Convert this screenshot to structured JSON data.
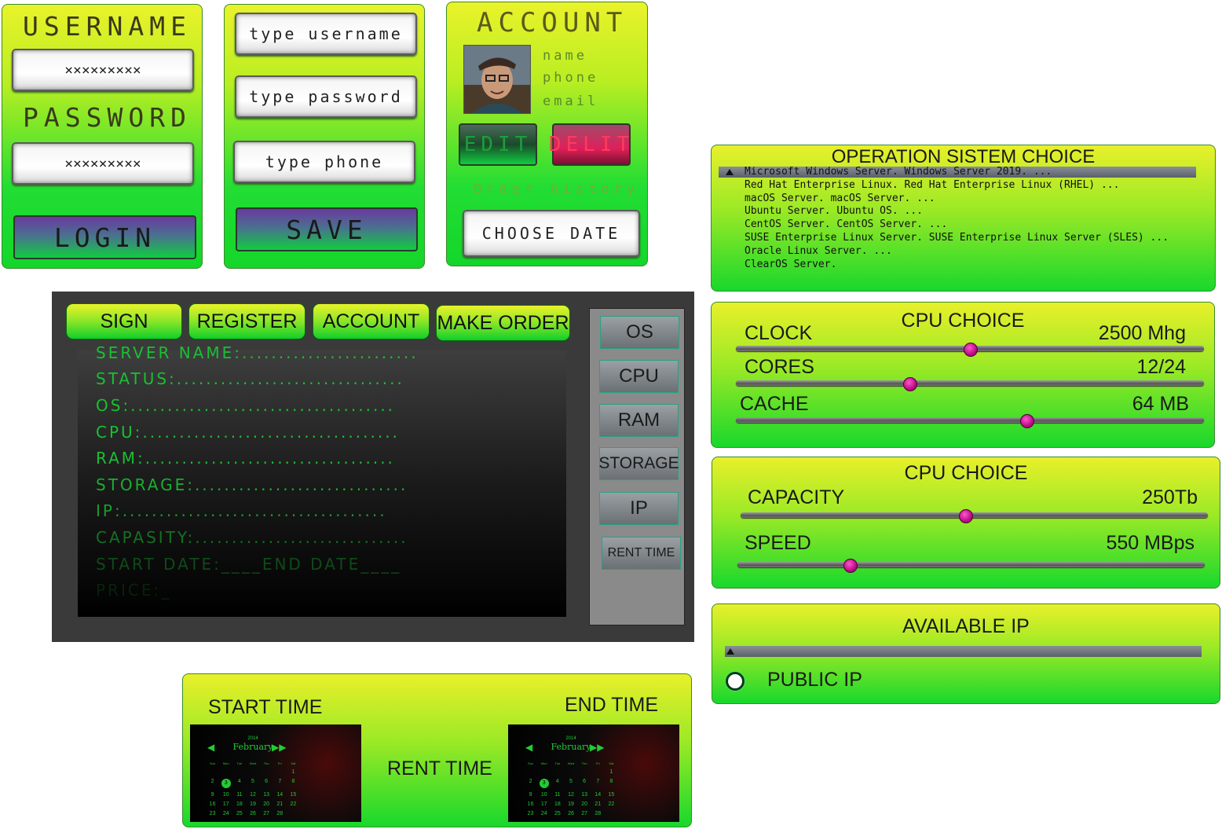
{
  "login": {
    "username_label": "USERNAME",
    "username_value": "×××××××××",
    "password_label": "PASSWORD",
    "password_value": "×××××××××",
    "login_button": "LOGIN"
  },
  "register": {
    "username_placeholder": "type username",
    "password_placeholder": "type password",
    "phone_placeholder": "type phone",
    "save_button": "SAVE"
  },
  "account": {
    "title": "ACCOUNT",
    "name": "name",
    "phone": "phone",
    "email": "email",
    "edit_button": "EDIT",
    "delete_button": "DELIT",
    "order_history": "Order history",
    "choose_date_button": "CHOOSE DATE"
  },
  "os_choice": {
    "title": "OPERATION SISTEM CHOICE",
    "items": [
      "Microsoft Windows Server. Windows Server 2019. ...",
      "Red Hat Enterprise Linux. Red Hat Enterprise Linux (RHEL) ...",
      "macOS Server. macOS Server. ...",
      "Ubuntu Server. Ubuntu OS. ...",
      "CentOS Server. CentOS Server. ...",
      "SUSE Enterprise Linux Server. SUSE Enterprise Linux Server (SLES) ...",
      "Oracle Linux Server. ...",
      "ClearOS Server."
    ],
    "selected_index": 0
  },
  "cpu_choice": {
    "title": "CPU CHOICE",
    "rows": [
      {
        "label": "CLOCK",
        "value": "2500 Mhg",
        "level": 0.5
      },
      {
        "label": "CORES",
        "value": "12/24",
        "level": 0.37
      },
      {
        "label": "CACHE",
        "value": "64 MB",
        "level": 0.62
      }
    ]
  },
  "storage_choice": {
    "title": "CPU CHOICE",
    "rows": [
      {
        "label": "CAPACITY",
        "value": "250Tb",
        "level": 0.48
      },
      {
        "label": "SPEED",
        "value": "550 MBps",
        "level": 0.24
      }
    ]
  },
  "available_ip": {
    "title": "AVAILABLE IP",
    "public_ip_label": "PUBLIC IP"
  },
  "main": {
    "tabs": [
      "SIGN",
      "REGISTER",
      "ACCOUNT",
      "MAKE ORDER"
    ],
    "status_lines": [
      "SERVER NAME:........................",
      "STATUS:...............................",
      "OS:....................................",
      "CPU:...................................",
      "RAM:..................................",
      "STORAGE:.............................",
      "IP:....................................",
      "CAPASITY:.............................",
      "START DATE:____END DATE____",
      "PRICE:_"
    ],
    "side_buttons": [
      "OS",
      "CPU",
      "RAM",
      "STORAGE",
      "IP",
      "RENT TIME"
    ]
  },
  "rent": {
    "start_label": "START TIME",
    "end_label": "END TIME",
    "center_label": "RENT TIME",
    "calendar": {
      "year": "2014",
      "month": "February",
      "weekdays": [
        "Sun",
        "Mon",
        "Tue",
        "Wed",
        "Thu",
        "Fri",
        "Sat"
      ],
      "days": [
        "",
        "",
        "",
        "",
        "",
        "",
        "1",
        "2",
        "3",
        "4",
        "5",
        "6",
        "7",
        "8",
        "9",
        "10",
        "11",
        "12",
        "13",
        "14",
        "15",
        "16",
        "17",
        "18",
        "19",
        "20",
        "21",
        "22",
        "23",
        "24",
        "25",
        "26",
        "27",
        "28"
      ],
      "selected_day": "3"
    }
  },
  "colors": {
    "panel_top": "#eaf22a",
    "panel_bottom": "#14d62a",
    "terminal_green": "#19c033",
    "knob": "#c0008a"
  }
}
